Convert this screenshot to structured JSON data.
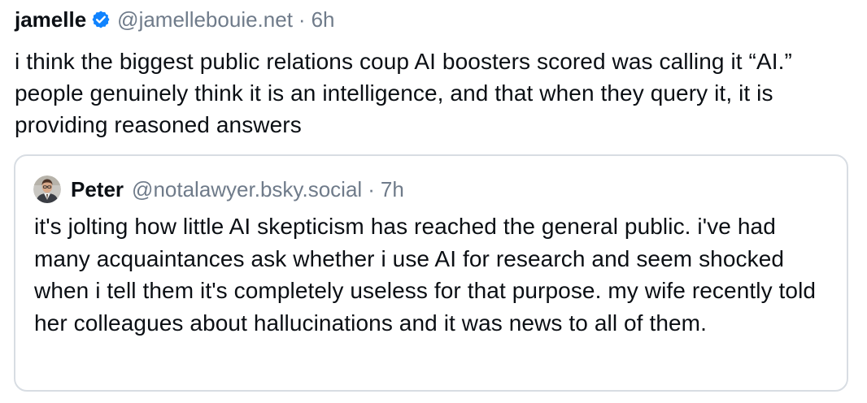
{
  "post": {
    "author_name": "jamelle",
    "handle": "@jamellebouie.net",
    "separator": "·",
    "time": "6h",
    "text": "i think the biggest public relations coup AI boosters scored was calling it “AI.” people genuinely think it is an intelligence, and that when they query it, it is providing reasoned answers",
    "verified_icon": "verified-checkmark-icon",
    "verified_color": "#1083fe"
  },
  "quote": {
    "author_name": "Peter",
    "handle": "@notalawyer.bsky.social",
    "separator": "·",
    "time": "7h",
    "text": "it's jolting how little AI skepticism has reached the general public. i've had many acquaintances ask whether i use AI for research and seem shocked when i tell them it's completely useless for that purpose. my wife recently told her colleagues about hallucinations and it was news to all of them."
  },
  "colors": {
    "text": "#0b0f14",
    "muted": "#6f7b8a",
    "border": "#d8dde3"
  }
}
